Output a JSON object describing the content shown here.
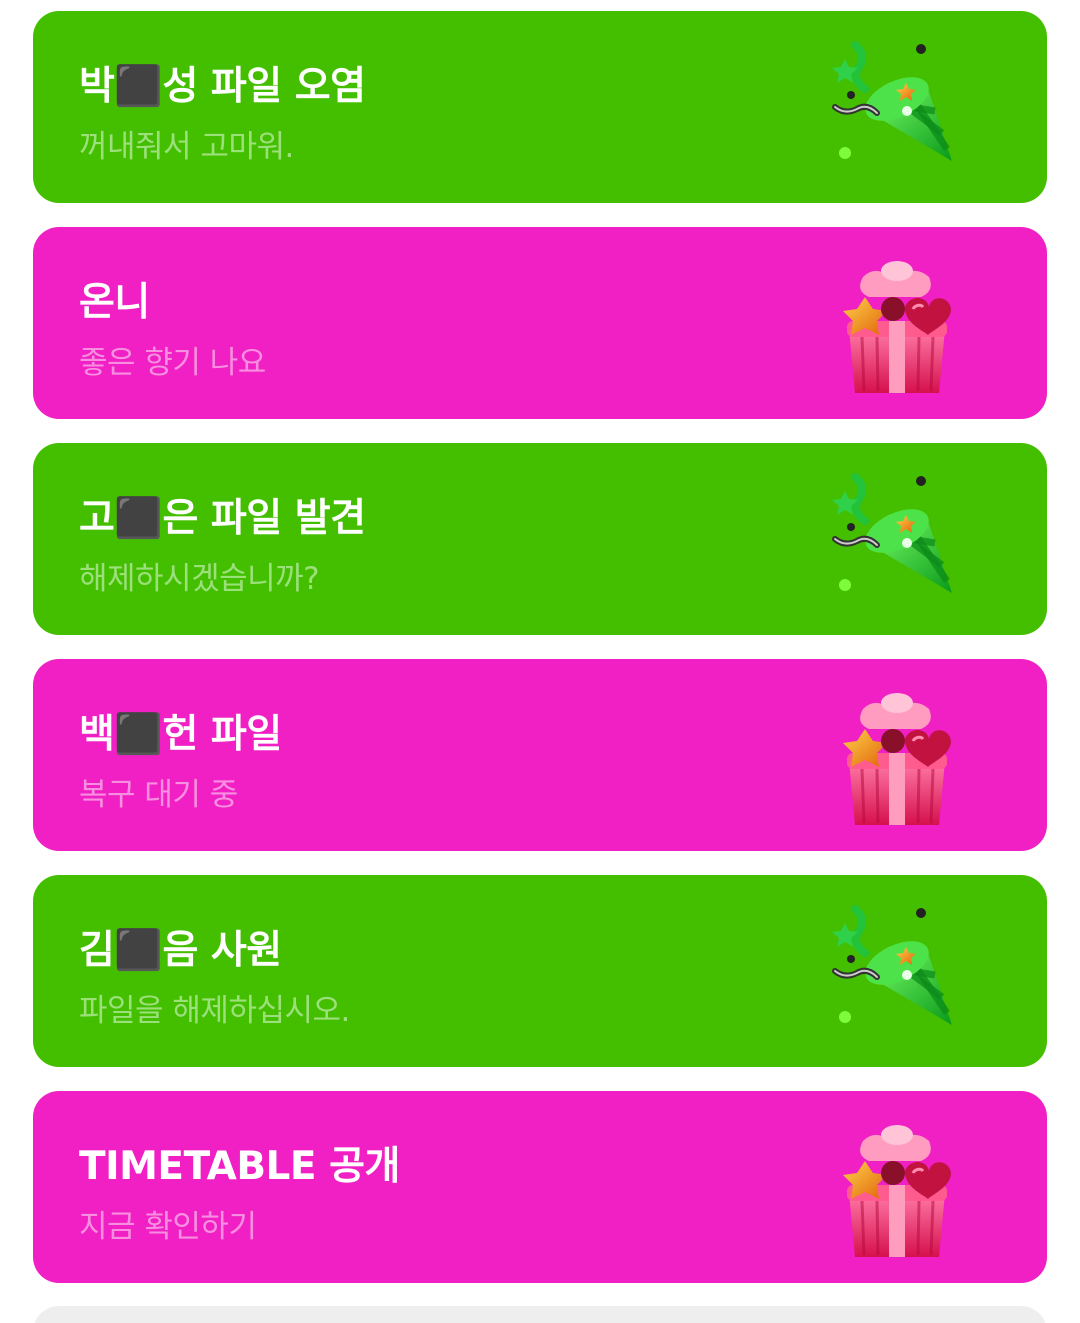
{
  "cards": [
    {
      "title": "박⬛성 파일 오염",
      "subtitle": "꺼내줘서 고마워.",
      "icon": "party-popper-icon",
      "color": "#44bf00"
    },
    {
      "title": "온니",
      "subtitle": "좋은 향기 나요",
      "icon": "gift-box-icon",
      "color": "#f020c4"
    },
    {
      "title": "고⬛은 파일 발견",
      "subtitle": "해제하시겠습니까?",
      "icon": "party-popper-icon",
      "color": "#44bf00"
    },
    {
      "title": "백⬛헌 파일",
      "subtitle": "복구 대기 중",
      "icon": "gift-box-icon",
      "color": "#f020c4"
    },
    {
      "title": "김⬛음 사원",
      "subtitle": "파일을 해제하십시오.",
      "icon": "party-popper-icon",
      "color": "#44bf00"
    },
    {
      "title": "TIMETABLE 공개",
      "subtitle": "지금 확인하기",
      "icon": "gift-box-icon",
      "color": "#f020c4"
    }
  ]
}
